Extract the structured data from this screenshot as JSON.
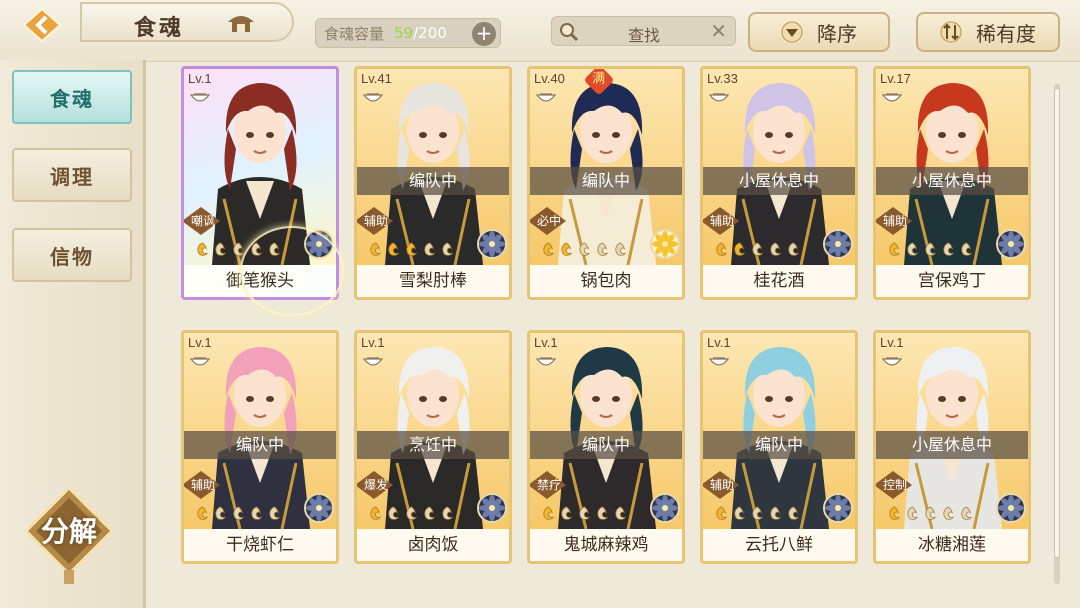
{
  "header": {
    "title": "食魂",
    "capacity": {
      "label": "食魂容量",
      "current": "59",
      "separator": "/",
      "max": "200"
    },
    "search_label": "查找",
    "sort_order_label": "降序",
    "sort_rarity_label": "稀有度"
  },
  "sidebar": {
    "items": [
      {
        "label": "食魂",
        "active": true
      },
      {
        "label": "调理",
        "active": false
      },
      {
        "label": "信物",
        "active": false
      }
    ],
    "decompose_label": "分解"
  },
  "colors": {
    "accent_green": "#9bd449",
    "active_tab": "#b3e0dc",
    "card_border": "#e7c472",
    "status_band": "#584e42"
  },
  "cards": [
    {
      "level": "Lv.1",
      "name": "御笔猴头",
      "status": "",
      "role": "嘲讽",
      "full": "",
      "rainbow": true,
      "stars": 1,
      "element": "flower-blue",
      "hair": "#8b2d22",
      "outfit": "#2c2a28"
    },
    {
      "level": "Lv.41",
      "name": "雪梨肘棒",
      "status": "编队中",
      "role": "辅助",
      "full": "",
      "rainbow": false,
      "stars": 3,
      "element": "flower-blue",
      "hair": "#e8e4df",
      "outfit": "#2a2a2a"
    },
    {
      "level": "Lv.40",
      "name": "锅包肉",
      "status": "编队中",
      "role": "必中",
      "full": "满",
      "rainbow": false,
      "stars": 2,
      "element": "flower-gold",
      "hair": "#1f2a55",
      "outfit": "#f5ecd6"
    },
    {
      "level": "Lv.33",
      "name": "桂花酒",
      "status": "小屋休息中",
      "role": "辅助",
      "full": "",
      "rainbow": false,
      "stars": 2,
      "element": "flower-blue",
      "hair": "#cfc3e6",
      "outfit": "#2d2a2e"
    },
    {
      "level": "Lv.17",
      "name": "宫保鸡丁",
      "status": "小屋休息中",
      "role": "辅助",
      "full": "",
      "rainbow": false,
      "stars": 1,
      "element": "flower-blue",
      "hair": "#c7391e",
      "outfit": "#1f3438"
    },
    {
      "level": "Lv.1",
      "name": "干烧虾仁",
      "status": "编队中",
      "role": "辅助",
      "full": "",
      "rainbow": false,
      "stars": 1,
      "element": "flower-blue",
      "hair": "#f3a0b9",
      "outfit": "#2f3040"
    },
    {
      "level": "Lv.1",
      "name": "卤肉饭",
      "status": "烹饪中",
      "role": "爆发",
      "full": "",
      "rainbow": false,
      "stars": 1,
      "element": "flower-blue",
      "hair": "#f0f0ee",
      "outfit": "#2b2928"
    },
    {
      "level": "Lv.1",
      "name": "鬼城麻辣鸡",
      "status": "编队中",
      "role": "禁疗",
      "full": "",
      "rainbow": false,
      "stars": 1,
      "element": "flower-blue",
      "hair": "#1f3a44",
      "outfit": "#2e2a2c"
    },
    {
      "level": "Lv.1",
      "name": "云托八鲜",
      "status": "编队中",
      "role": "辅助",
      "full": "",
      "rainbow": false,
      "stars": 1,
      "element": "flower-blue",
      "hair": "#8fd0e0",
      "outfit": "#2f3640"
    },
    {
      "level": "Lv.1",
      "name": "冰糖湘莲",
      "status": "小屋休息中",
      "role": "控制",
      "full": "",
      "rainbow": false,
      "stars": 1,
      "element": "flower-blue",
      "hair": "#eef0f2",
      "outfit": "#e8e6e2"
    }
  ]
}
